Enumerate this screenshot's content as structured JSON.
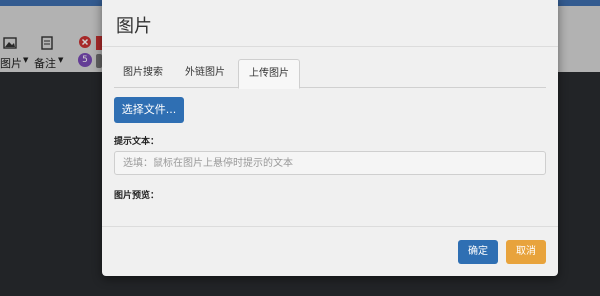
{
  "background": {
    "toolbar": {
      "image_label": "图片",
      "note_label": "备注",
      "badge_number": "5"
    }
  },
  "dialog": {
    "title": "图片",
    "tabs": [
      {
        "label": "图片搜索",
        "active": false
      },
      {
        "label": "外链图片",
        "active": false
      },
      {
        "label": "上传图片",
        "active": true
      }
    ],
    "select_file_label": "选择文件...",
    "hint_label": "提示文本：",
    "hint_placeholder": "选填：鼠标在图片上悬停时提示的文本",
    "preview_label": "图片预览：",
    "ok_label": "确定",
    "cancel_label": "取消"
  },
  "colors": {
    "primary": "#2f6fb3",
    "warning": "#e8a33c"
  }
}
